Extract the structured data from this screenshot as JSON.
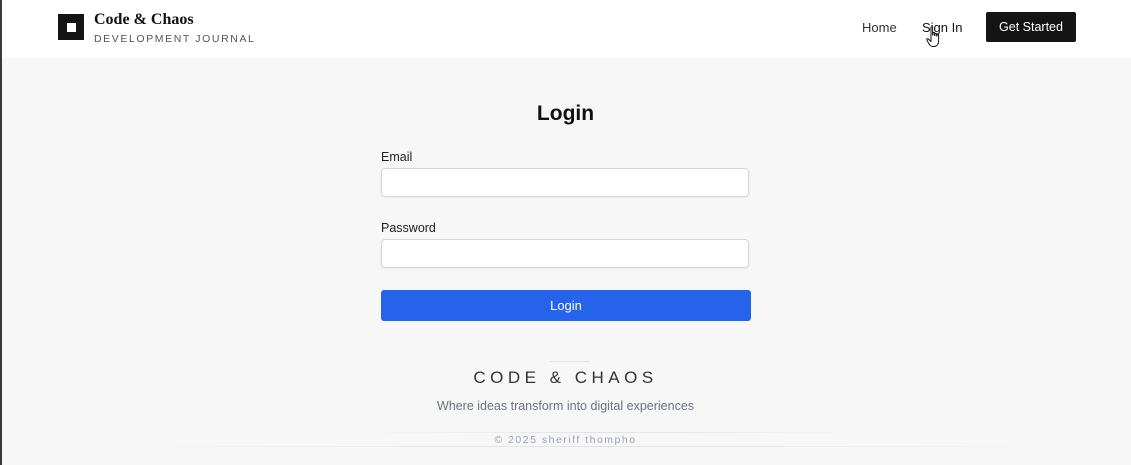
{
  "header": {
    "brand_title": "Code & Chaos",
    "brand_subtitle": "DEVELOPMENT JOURNAL",
    "nav": {
      "home": "Home",
      "sign_in": "Sign In"
    },
    "cta_label": "Get Started"
  },
  "login": {
    "title": "Login",
    "email_label": "Email",
    "email_value": "",
    "password_label": "Password",
    "password_value": "",
    "submit_label": "Login"
  },
  "footer": {
    "name": "CODE & CHAOS",
    "tagline": "Where ideas transform into digital experiences",
    "copyright": "© 2025 sheriff thompho"
  },
  "colors": {
    "accent": "#2563eb",
    "dark": "#141414",
    "page_background": "#f7f7f7"
  },
  "icons": {
    "logo": "square-logo-icon",
    "cursor": "hand-pointer-icon"
  }
}
